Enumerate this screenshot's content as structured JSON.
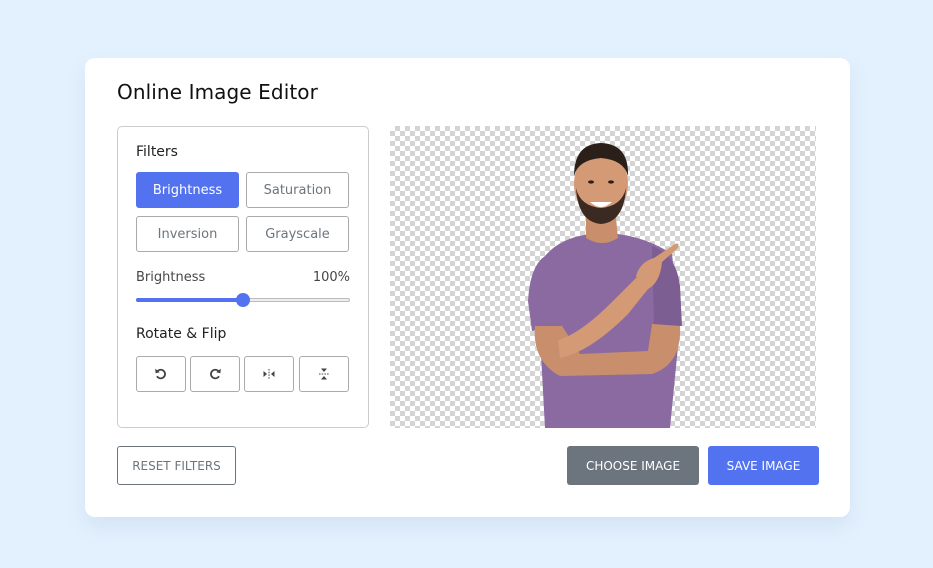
{
  "app": {
    "title": "Online Image Editor"
  },
  "filters": {
    "title": "Filters",
    "buttons": [
      {
        "label": "Brightness",
        "active": true
      },
      {
        "label": "Saturation",
        "active": false
      },
      {
        "label": "Inversion",
        "active": false
      },
      {
        "label": "Grayscale",
        "active": false
      }
    ],
    "slider": {
      "label": "Brightness",
      "value_text": "100%",
      "value": 100,
      "min": 0,
      "max": 200
    }
  },
  "rotate_flip": {
    "title": "Rotate & Flip",
    "buttons": [
      {
        "icon": "rotate-left-icon"
      },
      {
        "icon": "rotate-right-icon"
      },
      {
        "icon": "flip-horizontal-icon"
      },
      {
        "icon": "flip-vertical-icon"
      }
    ]
  },
  "preview": {
    "image_description": "Smiling bearded man in purple t-shirt pointing up on transparent background"
  },
  "actions": {
    "reset_label": "RESET FILTERS",
    "choose_label": "CHOOSE IMAGE",
    "save_label": "SAVE IMAGE"
  },
  "colors": {
    "accent": "#5372f0",
    "secondary": "#6c757d",
    "page_bg": "#e3f1fe"
  }
}
